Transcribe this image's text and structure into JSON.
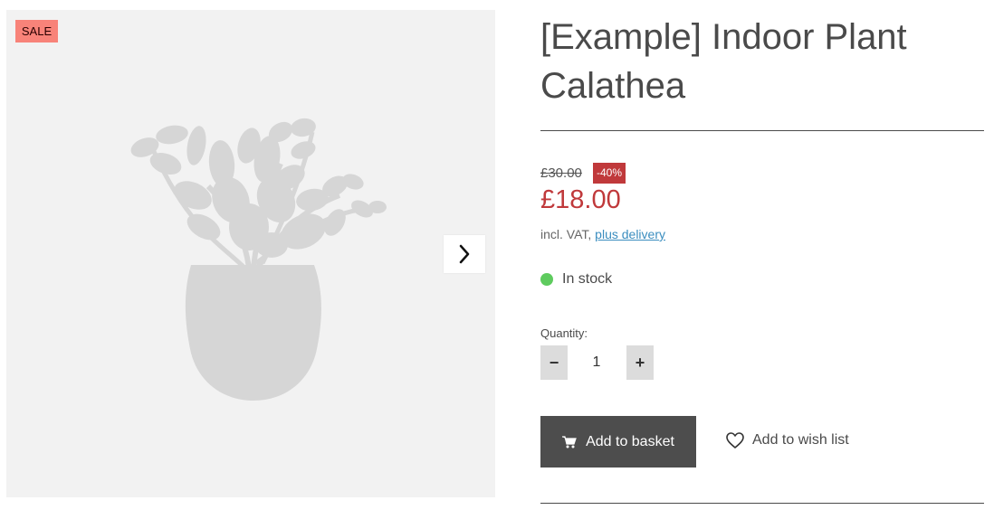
{
  "gallery": {
    "sale_badge": "SALE",
    "image_icon": "plant-pot-illustration",
    "next_icon": "chevron-right-icon"
  },
  "product": {
    "title": "[Example] Indoor Plant Calathea",
    "old_price": "£30.00",
    "discount": "-40%",
    "price": "£18.00",
    "vat_text": "incl. VAT,",
    "delivery_link": "plus delivery",
    "stock_status": "In stock",
    "stock_color": "#5ecb5e",
    "price_color": "#c0393b"
  },
  "quantity": {
    "label": "Quantity:",
    "value": "1",
    "minus": "−",
    "plus": "+"
  },
  "actions": {
    "basket_label": "Add to basket",
    "basket_icon": "cart-icon",
    "wishlist_label": "Add to wish list",
    "wishlist_icon": "heart-icon"
  }
}
